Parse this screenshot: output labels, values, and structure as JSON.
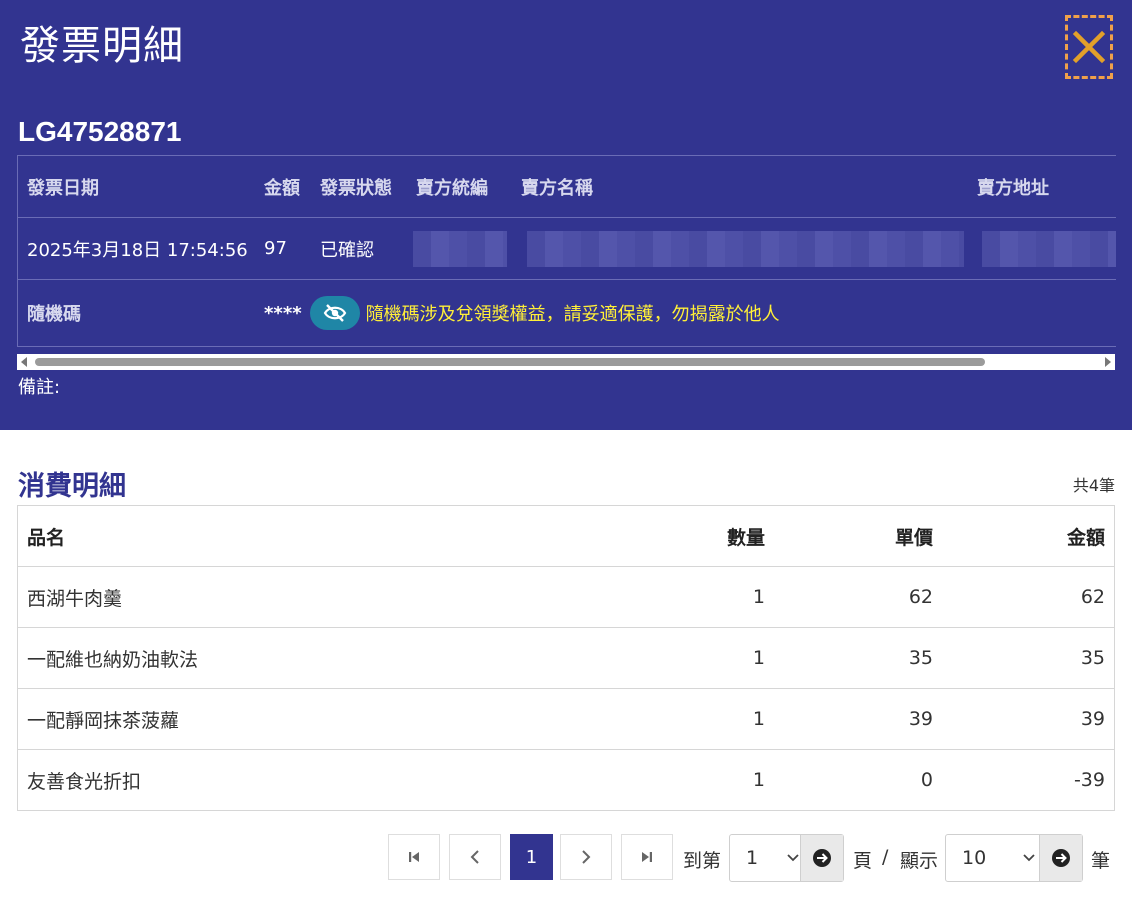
{
  "header": {
    "title": "發票明細",
    "invoice_number": "LG47528871"
  },
  "info_table": {
    "columns": [
      "發票日期",
      "金額",
      "發票狀態",
      "賣方統編",
      "賣方名稱",
      "賣方地址"
    ],
    "row": {
      "date": "2025年3月18日 17:54:56",
      "amount": "97",
      "status": "已確認"
    },
    "random_code_label": "隨機碼",
    "random_code_value": "****",
    "random_code_warning": "隨機碼涉及兌領獎權益，請妥適保護，勿揭露於他人"
  },
  "remark_label": "備註:",
  "details": {
    "title": "消費明細",
    "count_text": "共4筆",
    "columns": [
      "品名",
      "數量",
      "單價",
      "金額"
    ],
    "rows": [
      {
        "name": "西湖牛肉羹",
        "qty": "1",
        "price": "62",
        "amount": "62"
      },
      {
        "name": "一配維也納奶油軟法",
        "qty": "1",
        "price": "35",
        "amount": "35"
      },
      {
        "name": "一配靜岡抹茶菠蘿",
        "qty": "1",
        "price": "39",
        "amount": "39"
      },
      {
        "name": "友善食光折扣",
        "qty": "1",
        "price": "0",
        "amount": "-39"
      }
    ]
  },
  "pagination": {
    "current_page": "1",
    "goto_label": "到第",
    "goto_value": "1",
    "page_label": "頁",
    "separator": "/",
    "display_label": "顯示",
    "page_size": "10",
    "unit_label": "筆"
  },
  "colors": {
    "panel_bg": "#323490",
    "warning_text": "#ffef38",
    "eye_button": "#1f86a6",
    "close_border": "#f0a04a"
  }
}
